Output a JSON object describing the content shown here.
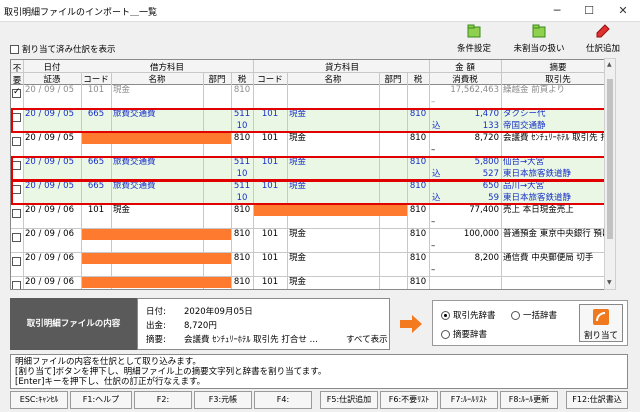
{
  "window": {
    "title": "取引明細ファイルのインポート＿一覧",
    "min": "─",
    "max": "☐",
    "close": "✕"
  },
  "toolbar": {
    "condition": "条件設定",
    "unassigned": "未割当の扱い",
    "add_entry": "仕訳追加"
  },
  "filter": {
    "label": "割り当て済み仕訳を表示",
    "checked": false
  },
  "headers": {
    "group_date": "日付",
    "group_debit": "借方科目",
    "group_credit": "貸方科目",
    "group_amount": "金 額",
    "group_summary": "摘要",
    "unused": "不要",
    "voucher": "証憑",
    "code": "コード",
    "name": "名称",
    "dept": "部門",
    "tax": "税",
    "consumption_tax": "消費税",
    "partner": "取引先"
  },
  "rows": [
    {
      "date": "20 / 09 / 05",
      "d_code": "101",
      "d_name": "現金",
      "d_tax": "810",
      "amount": "17,562,463",
      "summary": "繰越金 前頁より",
      "sub_tax": "",
      "tax_amount": "",
      "partner": "",
      "checked": true,
      "style": "gray"
    },
    {
      "date": "20 / 09 / 05",
      "d_code": "665",
      "d_name": "旅費交通費",
      "d_tax": "511",
      "c_code": "101",
      "c_name": "現金",
      "c_tax": "810",
      "amount": "1,470",
      "summary": "タクシー代",
      "sub_tax": "10",
      "tax_label": "込",
      "tax_amount": "133",
      "partner": "帝国交通静",
      "style": "blue"
    },
    {
      "date": "20 / 09 / 05",
      "d_tax": "810",
      "c_code": "101",
      "c_name": "現金",
      "c_tax": "810",
      "amount": "8,720",
      "summary": "会議費 ｾﾝﾁｭﾘｰﾎﾃﾙ 取引先 打",
      "style": "normal"
    },
    {
      "date": "20 / 09 / 05",
      "d_code": "665",
      "d_name": "旅費交通費",
      "d_tax": "511",
      "c_code": "101",
      "c_name": "現金",
      "c_tax": "810",
      "amount": "5,800",
      "summary": "仙台→大宮",
      "sub_tax": "10",
      "tax_label": "込",
      "tax_amount": "527",
      "partner": "東日本旅客鉄道静",
      "style": "blue"
    },
    {
      "date": "20 / 09 / 05",
      "d_code": "665",
      "d_name": "旅費交通費",
      "d_tax": "511",
      "c_code": "101",
      "c_name": "現金",
      "c_tax": "810",
      "amount": "650",
      "summary": "品川→大宮",
      "sub_tax": "10",
      "tax_label": "込",
      "tax_amount": "59",
      "partner": "東日本旅客鉄道静",
      "style": "blue"
    },
    {
      "date": "20 / 09 / 06",
      "d_code": "101",
      "d_name": "現金",
      "d_tax": "810",
      "c_tax": "810",
      "amount": "77,400",
      "summary": "売上 本日現金売上",
      "style": "normal"
    },
    {
      "date": "20 / 09 / 06",
      "d_tax": "810",
      "c_code": "101",
      "c_name": "現金",
      "c_tax": "810",
      "amount": "100,000",
      "summary": "普通預金 東京中央銀行 預け入",
      "style": "normal"
    },
    {
      "date": "20 / 09 / 06",
      "d_tax": "810",
      "c_code": "101",
      "c_name": "現金",
      "c_tax": "810",
      "amount": "8,200",
      "summary": "通信費 中央郵便局 切手",
      "style": "normal"
    },
    {
      "date": "20 / 09 / 06",
      "d_tax": "810",
      "c_code": "101",
      "c_name": "現金",
      "c_tax": "810",
      "amount": "",
      "summary": "",
      "style": "normal"
    }
  ],
  "detail": {
    "panel_label": "取引明細ファイルの内容",
    "date_label": "日付:",
    "date_value": "2020年09月05日",
    "out_label": "出金:",
    "out_value": "8,720円",
    "summary_label": "摘要:",
    "summary_value": "会議費 ｾﾝﾁｭﾘｰﾎﾃﾙ 取引先 打合せ …",
    "show_all": "すべて表示"
  },
  "dictionary": {
    "opt_partner": "取引先辞書",
    "opt_bulk": "一括辞書",
    "opt_summary": "摘要辞書",
    "assign_button": "割り当て",
    "selected": "取引先辞書"
  },
  "message": {
    "line1": "明細ファイルの内容を仕訳として取り込みます。",
    "line2": "[割り当て]ボタンを押下し、明細ファイル上の摘要文字列と辞書を割り当てます。",
    "line3": "[Enter]キーを押下し、仕訳の訂正が行なえます。"
  },
  "fkeys": [
    "ESC:ｷｬﾝｾﾙ",
    "F1:ヘルプ",
    "F2:",
    "F3:元帳",
    "F4:",
    "F5:仕訳追加",
    "F6:不要ﾘｽﾄ",
    "F7:ﾙｰﾙﾘｽﾄ",
    "F8:ﾙｰﾙ更新",
    "F12:仕訳書込"
  ],
  "colors": {
    "accent_orange": "#fe7a2e",
    "highlight_red": "#e00000",
    "link_blue": "#1530c8",
    "row_green": "#eaf7e4"
  }
}
